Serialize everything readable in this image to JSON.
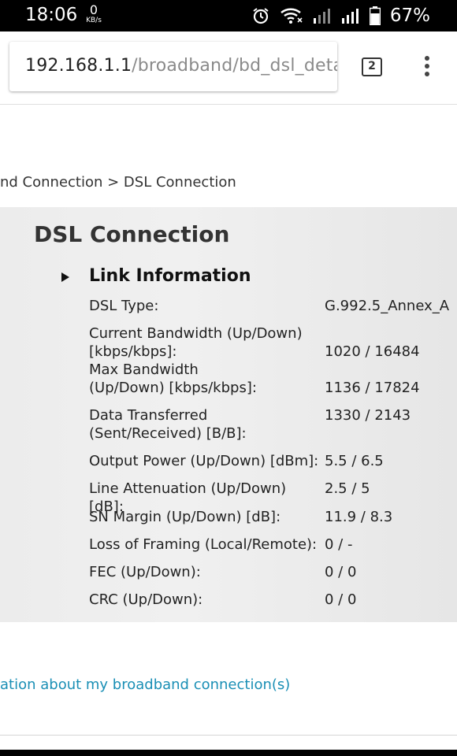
{
  "status_bar": {
    "time": "18:06",
    "net_speed_value": "0",
    "net_speed_unit": "KB/s",
    "battery_percent": "67%",
    "icons": [
      "alarm-icon",
      "wifi-icon",
      "signal-icon",
      "signal-icon",
      "battery-icon"
    ]
  },
  "browser": {
    "url_host": "192.168.1.1",
    "url_path": "/broadband/bd_dsl_detail",
    "tab_count": "2"
  },
  "page": {
    "breadcrumb": "nd Connection > DSL Connection",
    "title": "DSL Connection",
    "section_title": "Link Information",
    "rows": [
      {
        "label": "DSL Type:",
        "value": "G.992.5_Annex_A"
      },
      {
        "label": "Current Bandwidth (Up/Down) [kbps/kbps]:",
        "value": "1020 / 16484"
      },
      {
        "label": "Max Bandwidth (Up/Down) [kbps/kbps]:",
        "value": "1136 / 17824"
      },
      {
        "label": "Data Transferred (Sent/Received) [B/B]:",
        "value": "1330 / 2143"
      },
      {
        "label": "Output Power (Up/Down) [dBm]:",
        "value": "5.5 / 6.5"
      },
      {
        "label": "Line Attenuation (Up/Down) [dB]:",
        "value": "2.5 / 5"
      },
      {
        "label": "SN Margin (Up/Down) [dB]:",
        "value": "11.9 / 8.3"
      },
      {
        "label": "Loss of Framing (Local/Remote):",
        "value": "0 / -"
      },
      {
        "label": "FEC (Up/Down):",
        "value": "0 / 0"
      },
      {
        "label": "CRC (Up/Down):",
        "value": "0 / 0"
      }
    ],
    "footer_link": "ation about my broadband connection(s)"
  }
}
